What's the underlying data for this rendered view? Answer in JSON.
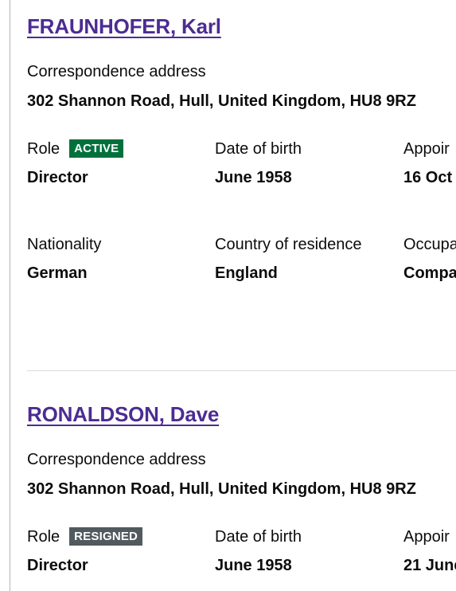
{
  "labels": {
    "correspondence_address": "Correspondence address",
    "role": "Role",
    "date_of_birth": "Date of birth",
    "appointed_on": "Appoir",
    "nationality": "Nationality",
    "country_of_residence": "Country of residence",
    "occupation": "Occupa"
  },
  "officers": [
    {
      "name": "FRAUNHOFER, Karl",
      "address": "302 Shannon Road, Hull, United Kingdom, HU8 9RZ",
      "status": "ACTIVE",
      "status_color": "#00703c",
      "role": "Director",
      "date_of_birth": "June 1958",
      "appointed_on": "16 Oct",
      "nationality": "German",
      "country_of_residence": "England",
      "occupation": "Compa"
    },
    {
      "name": "RONALDSON, Dave",
      "address": "302 Shannon Road, Hull, United Kingdom, HU8 9RZ",
      "status": "RESIGNED",
      "status_color": "#505a5f",
      "role": "Director",
      "date_of_birth": "June 1958",
      "appointed_on": "21 June"
    }
  ],
  "colors": {
    "link": "#4c2c92",
    "text": "#0b0c0c",
    "divider": "#dcdcdc"
  }
}
